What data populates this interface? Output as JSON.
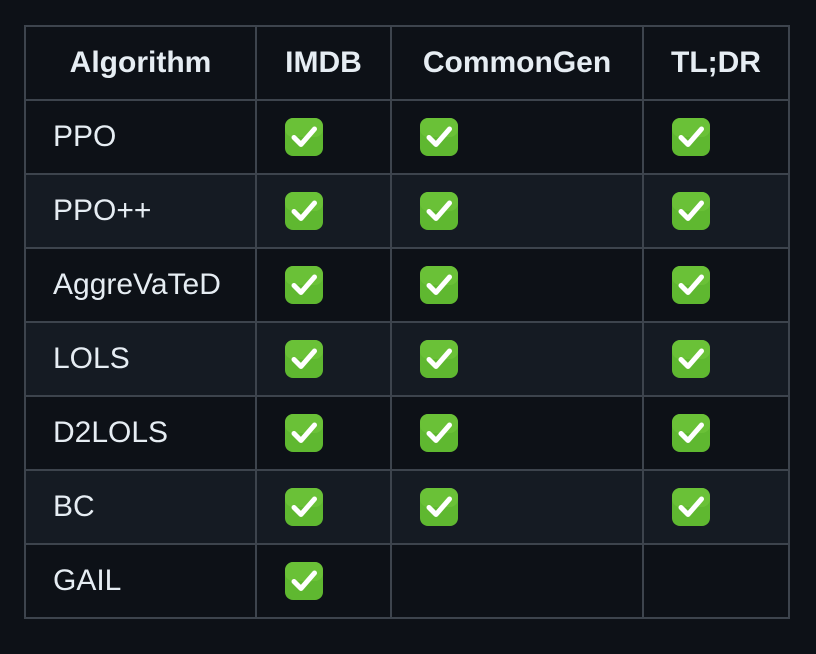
{
  "table": {
    "headers": [
      "Algorithm",
      "IMDB",
      "CommonGen",
      "TL;DR"
    ],
    "rows": [
      {
        "algorithm": "PPO",
        "imdb": true,
        "commongen": true,
        "tldr": true
      },
      {
        "algorithm": "PPO++",
        "imdb": true,
        "commongen": true,
        "tldr": true
      },
      {
        "algorithm": "AggreVaTeD",
        "imdb": true,
        "commongen": true,
        "tldr": true
      },
      {
        "algorithm": "LOLS",
        "imdb": true,
        "commongen": true,
        "tldr": true
      },
      {
        "algorithm": "D2LOLS",
        "imdb": true,
        "commongen": true,
        "tldr": true
      },
      {
        "algorithm": "BC",
        "imdb": true,
        "commongen": true,
        "tldr": true
      },
      {
        "algorithm": "GAIL",
        "imdb": true,
        "commongen": false,
        "tldr": false
      }
    ],
    "check_icon": "white-check-mark-icon",
    "colors": {
      "background": "#0d1117",
      "row_alt": "#151b23",
      "border": "#3d444d",
      "text": "#e6edf3",
      "check_green": "#5fb830"
    }
  }
}
